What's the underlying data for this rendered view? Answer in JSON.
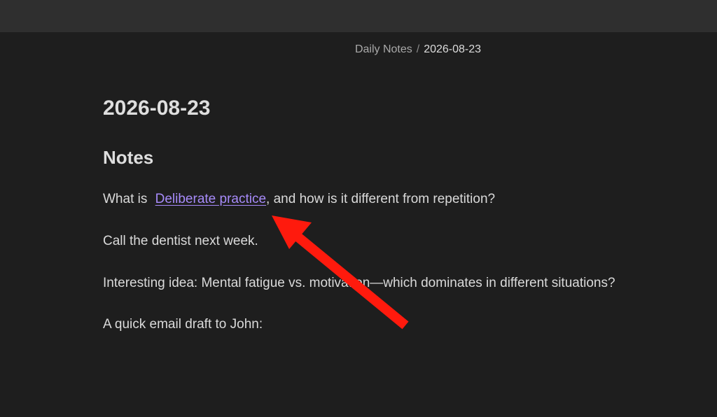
{
  "breadcrumb": {
    "parent": "Daily Notes",
    "separator": "/",
    "current": "2026-08-23"
  },
  "note": {
    "title": "2026-08-23",
    "heading": "Notes",
    "line1": {
      "before": "What is ",
      "link": "Deliberate practice",
      "after": ", and how is it different from repetition?"
    },
    "line2": "Call the dentist next week.",
    "line3": "Interesting idea: Mental fatigue vs. motivation—which dominates in different situations?",
    "line4": "A quick email draft to John:"
  },
  "annotation": {
    "arrow_color": "#ff1a0d"
  },
  "colors": {
    "background": "#1e1e1e",
    "topbar": "#2f2f2f",
    "link": "#a78bfa",
    "text": "#dadada"
  }
}
